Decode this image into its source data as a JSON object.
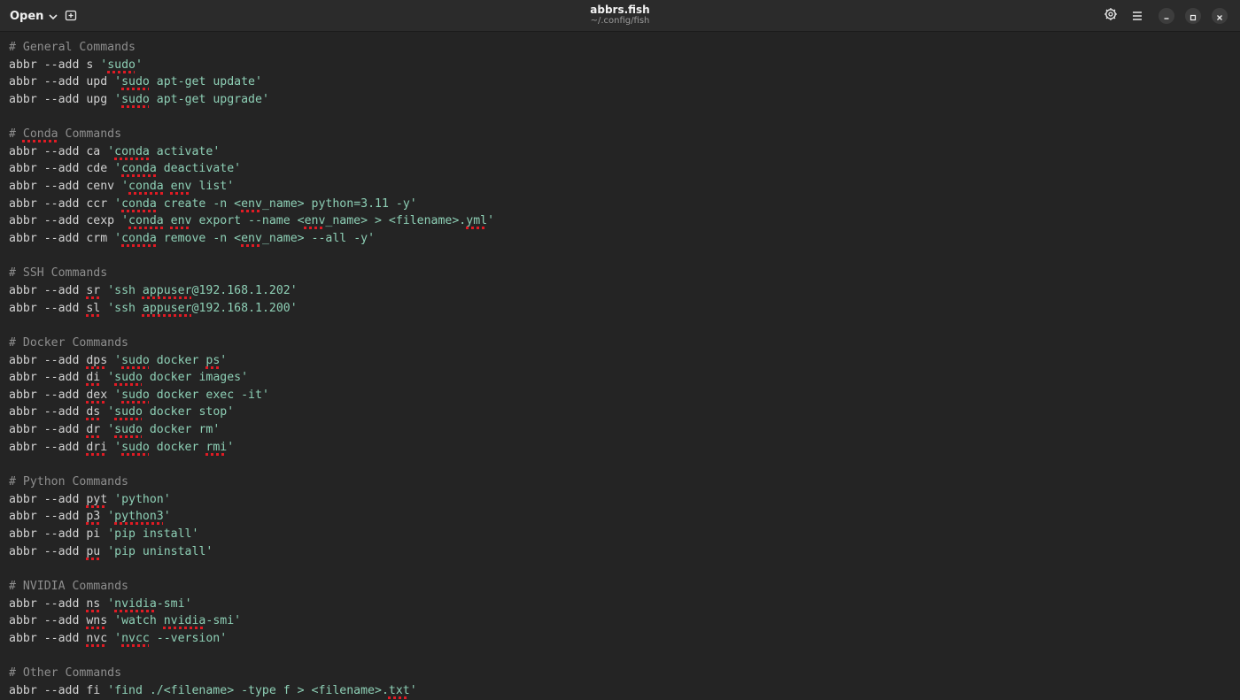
{
  "header": {
    "open_label": "Open",
    "title": "abbrs.fish",
    "subtitle": "~/.config/fish",
    "icons": [
      "new-tab-icon",
      "gear-icon",
      "hamburger-menu-icon",
      "minimize-icon",
      "maximize-icon",
      "close-icon"
    ]
  },
  "colors": {
    "background": "#242424",
    "header": "#2b2b2b",
    "comment": "#8e8e8e",
    "text": "#d2d2d2",
    "string": "#8ed0b6",
    "spell_error": "#e01b24"
  },
  "editor": {
    "lines": [
      {
        "type": "comment",
        "text": "# General Commands"
      },
      {
        "type": "abbr",
        "prefix": "abbr --add ",
        "name": "s",
        "value": "'sudo'"
      },
      {
        "type": "abbr",
        "prefix": "abbr --add ",
        "name": "upd",
        "value": "'sudo apt-get update'"
      },
      {
        "type": "abbr",
        "prefix": "abbr --add ",
        "name": "upg",
        "value": "'sudo apt-get upgrade'"
      },
      {
        "type": "blank",
        "text": ""
      },
      {
        "type": "comment",
        "text": "# Conda Commands"
      },
      {
        "type": "abbr",
        "prefix": "abbr --add ",
        "name": "ca",
        "value": "'conda activate'"
      },
      {
        "type": "abbr",
        "prefix": "abbr --add ",
        "name": "cde",
        "value": "'conda deactivate'"
      },
      {
        "type": "abbr",
        "prefix": "abbr --add ",
        "name": "cenv",
        "value": "'conda env list'"
      },
      {
        "type": "abbr",
        "prefix": "abbr --add ",
        "name": "ccr",
        "value": "'conda create -n <env_name> python=3.11 -y'"
      },
      {
        "type": "abbr",
        "prefix": "abbr --add ",
        "name": "cexp",
        "value": "'conda env export --name <env_name> > <filename>.yml'"
      },
      {
        "type": "abbr",
        "prefix": "abbr --add ",
        "name": "crm",
        "value": "'conda remove -n <env_name> --all -y'"
      },
      {
        "type": "blank",
        "text": ""
      },
      {
        "type": "comment",
        "text": "# SSH Commands"
      },
      {
        "type": "abbr",
        "prefix": "abbr --add ",
        "name": "sr",
        "value": "'ssh appuser@192.168.1.202'"
      },
      {
        "type": "abbr",
        "prefix": "abbr --add ",
        "name": "sl",
        "value": "'ssh appuser@192.168.1.200'"
      },
      {
        "type": "blank",
        "text": ""
      },
      {
        "type": "comment",
        "text": "# Docker Commands"
      },
      {
        "type": "abbr",
        "prefix": "abbr --add ",
        "name": "dps",
        "value": "'sudo docker ps'"
      },
      {
        "type": "abbr",
        "prefix": "abbr --add ",
        "name": "di",
        "value": "'sudo docker images'"
      },
      {
        "type": "abbr",
        "prefix": "abbr --add ",
        "name": "dex",
        "value": "'sudo docker exec -it'"
      },
      {
        "type": "abbr",
        "prefix": "abbr --add ",
        "name": "ds",
        "value": "'sudo docker stop'"
      },
      {
        "type": "abbr",
        "prefix": "abbr --add ",
        "name": "dr",
        "value": "'sudo docker rm'"
      },
      {
        "type": "abbr",
        "prefix": "abbr --add ",
        "name": "dri",
        "value": "'sudo docker rmi'"
      },
      {
        "type": "blank",
        "text": ""
      },
      {
        "type": "comment",
        "text": "# Python Commands"
      },
      {
        "type": "abbr",
        "prefix": "abbr --add ",
        "name": "pyt",
        "value": "'python'"
      },
      {
        "type": "abbr",
        "prefix": "abbr --add ",
        "name": "p3",
        "value": "'python3'"
      },
      {
        "type": "abbr",
        "prefix": "abbr --add ",
        "name": "pi",
        "value": "'pip install'"
      },
      {
        "type": "abbr",
        "prefix": "abbr --add ",
        "name": "pu",
        "value": "'pip uninstall'"
      },
      {
        "type": "blank",
        "text": ""
      },
      {
        "type": "comment",
        "text": "# NVIDIA Commands"
      },
      {
        "type": "abbr",
        "prefix": "abbr --add ",
        "name": "ns",
        "value": "'nvidia-smi'"
      },
      {
        "type": "abbr",
        "prefix": "abbr --add ",
        "name": "wns",
        "value": "'watch nvidia-smi'"
      },
      {
        "type": "abbr",
        "prefix": "abbr --add ",
        "name": "nvc",
        "value": "'nvcc --version'"
      },
      {
        "type": "blank",
        "text": ""
      },
      {
        "type": "comment",
        "text": "# Other Commands"
      },
      {
        "type": "abbr",
        "prefix": "abbr --add ",
        "name": "fi",
        "value": "'find ./<filename> -type f > <filename>.txt'"
      }
    ],
    "misspelled_words": [
      "sudo",
      "Conda",
      "conda",
      "env",
      "yml",
      "sr",
      "sl",
      "appuser",
      "dps",
      "ps",
      "di",
      "dex",
      "ds",
      "dr",
      "dri",
      "rmi",
      "pyt",
      "p3",
      "python3",
      "pu",
      "ns",
      "nvidia",
      "wns",
      "nvc",
      "nvcc",
      "txt"
    ]
  }
}
